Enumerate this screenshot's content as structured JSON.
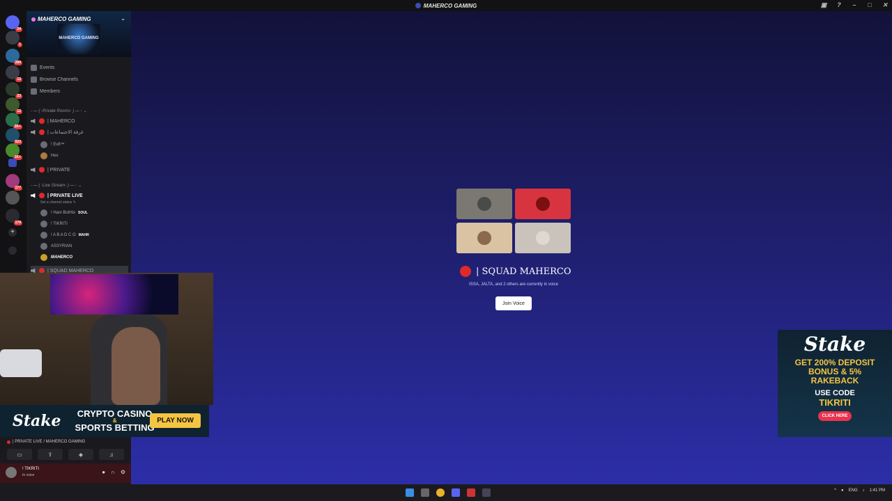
{
  "window": {
    "title": "MAHERCO GAMING"
  },
  "rail": {
    "badges": [
      "24",
      "1",
      "289",
      "13",
      "23",
      "12",
      "2K+",
      "523",
      "1K+",
      "177",
      "179"
    ]
  },
  "server": {
    "name": "MAHERCO GAMING",
    "banner_text": "MAHERCO GAMING"
  },
  "nav": {
    "events": "Events",
    "browse": "Browse Channels",
    "members": "Members"
  },
  "categories": {
    "private_rooms": "- — ( ◦Private Rooms◦ ) — ◦ ⌄",
    "live_stream": "- — ( ◦Live Stream◦ ) — ◦ ⌄"
  },
  "channels": {
    "maherco": "| MAHERCO",
    "arabic": "| غرفة الاجتماعات",
    "private": "| PRIVATE",
    "private_live": "| PRIVATE LIVE",
    "private_live_status": "Set a channel status ✎",
    "squad": "| SQUAD MAHERCO"
  },
  "room_members": [
    "! Ev8™",
    "Hex"
  ],
  "live_members": [
    {
      "name": "! Hani BotHix",
      "tag": "SOUL"
    },
    {
      "name": "! TIKRITI",
      "tag": ""
    },
    {
      "name": "! A B A D C O",
      "tag": "MAHR"
    },
    {
      "name": "ASSYRIAN",
      "tag": ""
    },
    {
      "name": "MAHERCO",
      "tag": ""
    }
  ],
  "voice": {
    "channel_title": "| SQUAD MAHERCO",
    "subtitle": "ISSA, JALTA, and 2 others are currently in voice",
    "join_label": "Join Voice",
    "tile_colors": [
      "#7b7872",
      "#d8343f",
      "#d9c3a3",
      "#c9c3bb"
    ]
  },
  "stake_banner": {
    "logo": "Stake",
    "line1": "CRYPTO CASINO",
    "amp": "&",
    "line2": "SPORTS BETTING",
    "cta": "PLAY NOW"
  },
  "stake_ad": {
    "logo": "Stake",
    "offer1": "GET 200% DEPOSIT",
    "offer2": "BONUS & 5%",
    "offer3": "RAKEBACK",
    "use": "USE CODE",
    "code": "TIKRITI",
    "cta": "CLICK HERE"
  },
  "voice_panel": {
    "connection": "| PRIVATE LIVE / MAHERCO GAMING"
  },
  "user": {
    "name": "! TIKRITI",
    "status": "In voice"
  },
  "tray": {
    "lang": "ENG",
    "time": "1:41 PM"
  },
  "colors": {
    "accent_red": "#e02a2a",
    "bg_gradient_bottom": "#2c2ea8",
    "stake_gold": "#f5c542"
  }
}
